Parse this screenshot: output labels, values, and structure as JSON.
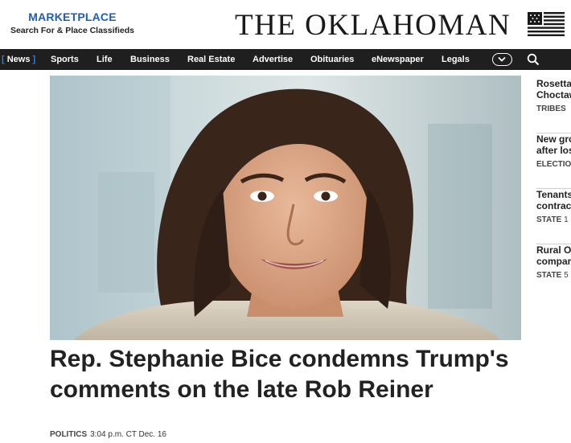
{
  "header": {
    "marketplace_title": "MARKETPLACE",
    "marketplace_subtitle": "Search For & Place Classifieds",
    "masthead": "THE OKLAHOMAN"
  },
  "nav": {
    "items": [
      {
        "label": "News",
        "active": true
      },
      {
        "label": "Sports"
      },
      {
        "label": "Life"
      },
      {
        "label": "Business"
      },
      {
        "label": "Real Estate"
      },
      {
        "label": "Advertise"
      },
      {
        "label": "Obituaries"
      },
      {
        "label": "eNewspaper"
      },
      {
        "label": "Legals"
      }
    ],
    "active_open": "[",
    "active_close": "]",
    "more_icon": "chevron-down-icon",
    "search_icon": "search-icon"
  },
  "hero": {
    "headline": "Rep. Stephanie Bice condemns Trump's comments on the late Rob Reiner",
    "section": "POLITICS",
    "timestamp": "3:04 p.m. CT Dec. 16"
  },
  "sidebar": {
    "items": [
      {
        "line1": "Rosetta",
        "line2": "Choctaw",
        "tag": "TRIBES",
        "tag_rest": ""
      },
      {
        "line1": "New gro",
        "line2": "after los",
        "tag": "ELECTIO",
        "tag_rest": ""
      },
      {
        "line1": "Tenants",
        "line2": "contrac",
        "tag": "STATE",
        "tag_rest": " 1"
      },
      {
        "line1": "Rural O",
        "line2": "compar",
        "tag": "STATE",
        "tag_rest": " 5"
      }
    ]
  },
  "colors": {
    "brand_blue": "#1f5fb3",
    "nav_bg": "#1f1f1f",
    "nav_active_bracket": "#2f7fd8"
  }
}
